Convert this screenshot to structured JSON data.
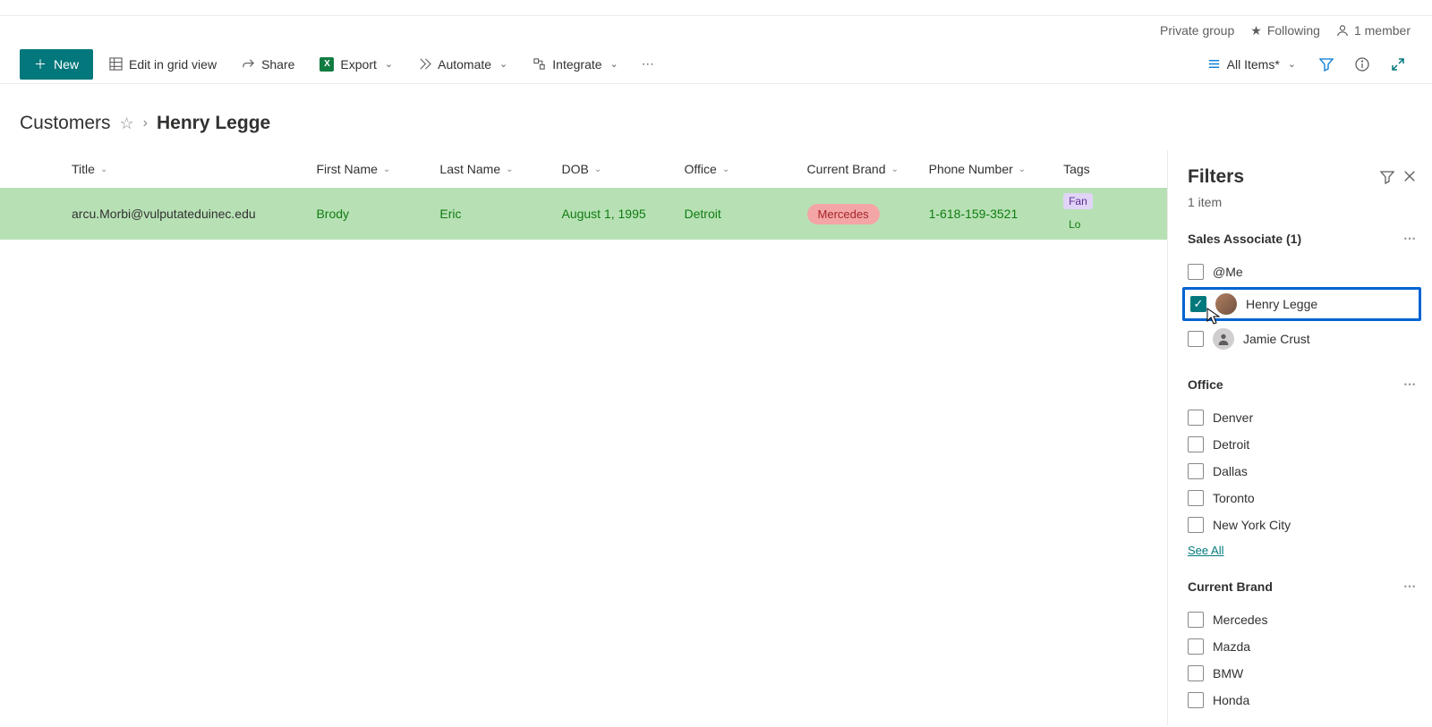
{
  "header": {
    "privacy": "Private group",
    "following": "Following",
    "members": "1 member"
  },
  "toolbar": {
    "new": "New",
    "edit_grid": "Edit in grid view",
    "share": "Share",
    "export": "Export",
    "automate": "Automate",
    "integrate": "Integrate",
    "view_selector": "All Items*"
  },
  "breadcrumb": {
    "root": "Customers",
    "current": "Henry Legge"
  },
  "columns": {
    "title": "Title",
    "first_name": "First Name",
    "last_name": "Last Name",
    "dob": "DOB",
    "office": "Office",
    "current_brand": "Current Brand",
    "phone": "Phone Number",
    "tags": "Tags"
  },
  "rows": [
    {
      "title": "arcu.Morbi@vulputateduinec.edu",
      "first_name": "Brody",
      "last_name": "Eric",
      "dob": "August 1, 1995",
      "office": "Detroit",
      "brand": "Mercedes",
      "phone": "1-618-159-3521",
      "tag1": "Fan",
      "tag2": "Lo"
    }
  ],
  "filters": {
    "title": "Filters",
    "count_label": "1 item",
    "groups": {
      "sales_associate": {
        "label": "Sales Associate (1)",
        "options": [
          {
            "label": "@Me",
            "checked": false,
            "avatar": false
          },
          {
            "label": "Henry Legge",
            "checked": true,
            "avatar": true,
            "highlighted": true
          },
          {
            "label": "Jamie Crust",
            "checked": false,
            "avatar": true
          }
        ]
      },
      "office": {
        "label": "Office",
        "options": [
          "Denver",
          "Detroit",
          "Dallas",
          "Toronto",
          "New York City"
        ],
        "see_all": "See All"
      },
      "current_brand": {
        "label": "Current Brand",
        "options": [
          "Mercedes",
          "Mazda",
          "BMW",
          "Honda"
        ]
      }
    }
  }
}
